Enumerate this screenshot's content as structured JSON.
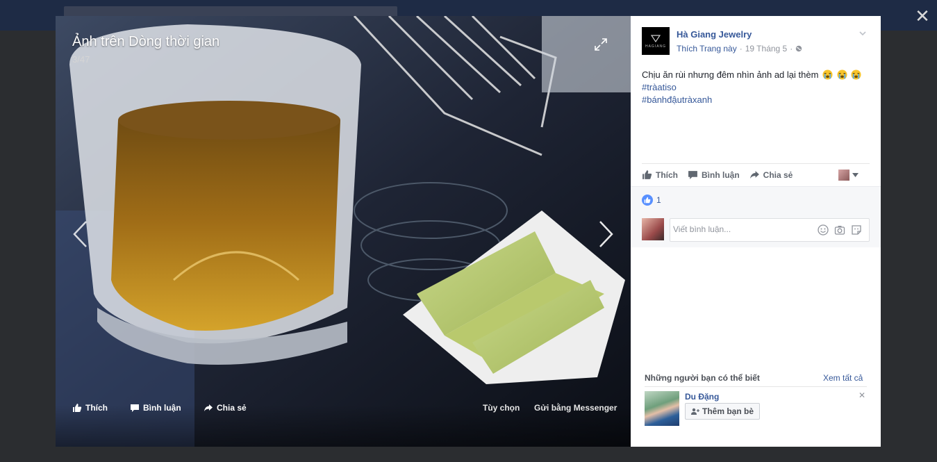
{
  "viewer": {
    "title": "Ảnh trên Dòng thời gian",
    "counter": "3/47",
    "actions": {
      "like": "Thích",
      "comment": "Bình luận",
      "share": "Chia sẻ",
      "options": "Tùy chọn",
      "send_messenger": "Gửi bằng Messenger"
    }
  },
  "post": {
    "page_name": "Hà Giang Jewelry",
    "logo_text": "HAGIANG",
    "like_page": "Thích Trang này",
    "date": "19 Tháng 5",
    "text": "Chịu ăn rùi nhưng đêm nhìn ảnh ad lại thèm",
    "hashtags": [
      "#tràatiso",
      "#bánhđậutràxanh"
    ],
    "actions": {
      "like": "Thích",
      "comment": "Bình luận",
      "share": "Chia sẻ"
    },
    "like_count": "1",
    "comment_placeholder": "Viết bình luận..."
  },
  "pymk": {
    "title": "Những người bạn có thể biết",
    "see_all": "Xem tất cả",
    "person_name": "Du Đặng",
    "add_friend": "Thêm bạn bè"
  },
  "colors": {
    "link": "#365899",
    "like_blue": "#5890ff",
    "overlay_bg": "#2b2d30"
  },
  "icons": [
    "close-icon",
    "expand-icon",
    "prev-arrow-icon",
    "next-arrow-icon",
    "like-icon",
    "comment-icon",
    "share-icon",
    "globe-icon",
    "chevron-down-icon",
    "emoji-icon",
    "camera-icon",
    "sticker-icon",
    "add-friend-icon"
  ]
}
